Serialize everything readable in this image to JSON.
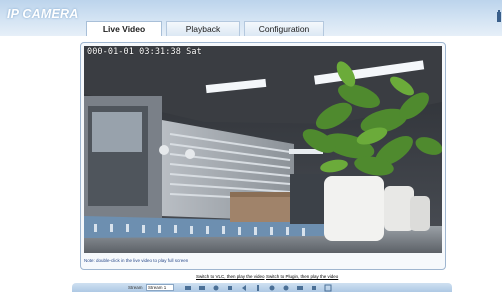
{
  "app": {
    "brand": "IP CAMERA"
  },
  "tabs": [
    {
      "label": "Live Video",
      "active": true
    },
    {
      "label": "Playback",
      "active": false
    },
    {
      "label": "Configuration",
      "active": false
    }
  ],
  "video": {
    "osd_timestamp": "000-01-01 03:31:38 Sat",
    "hint": "Note: double-click in the live video to play full screen"
  },
  "player_links": {
    "vlc": "Switch to VLC, then play the video",
    "plugin": "Switch to Plugin, then play the video"
  },
  "toolbar": {
    "stream_label": "Stream",
    "stream_value": "Stream 1",
    "icons": [
      "snapshot-icon",
      "record-icon",
      "zoom-icon",
      "audio-icon",
      "talk-icon",
      "color-icon",
      "fullscreen-icon",
      "settings-icon",
      "ptz-icon",
      "info-icon",
      "expand-icon"
    ]
  },
  "colors": {
    "header_top": "#bcd4ec",
    "header_bottom": "#e6eff8",
    "tab_border": "#a8bfd8",
    "frame_border": "#9fb6d0",
    "toolbar": "#aac6e3"
  }
}
